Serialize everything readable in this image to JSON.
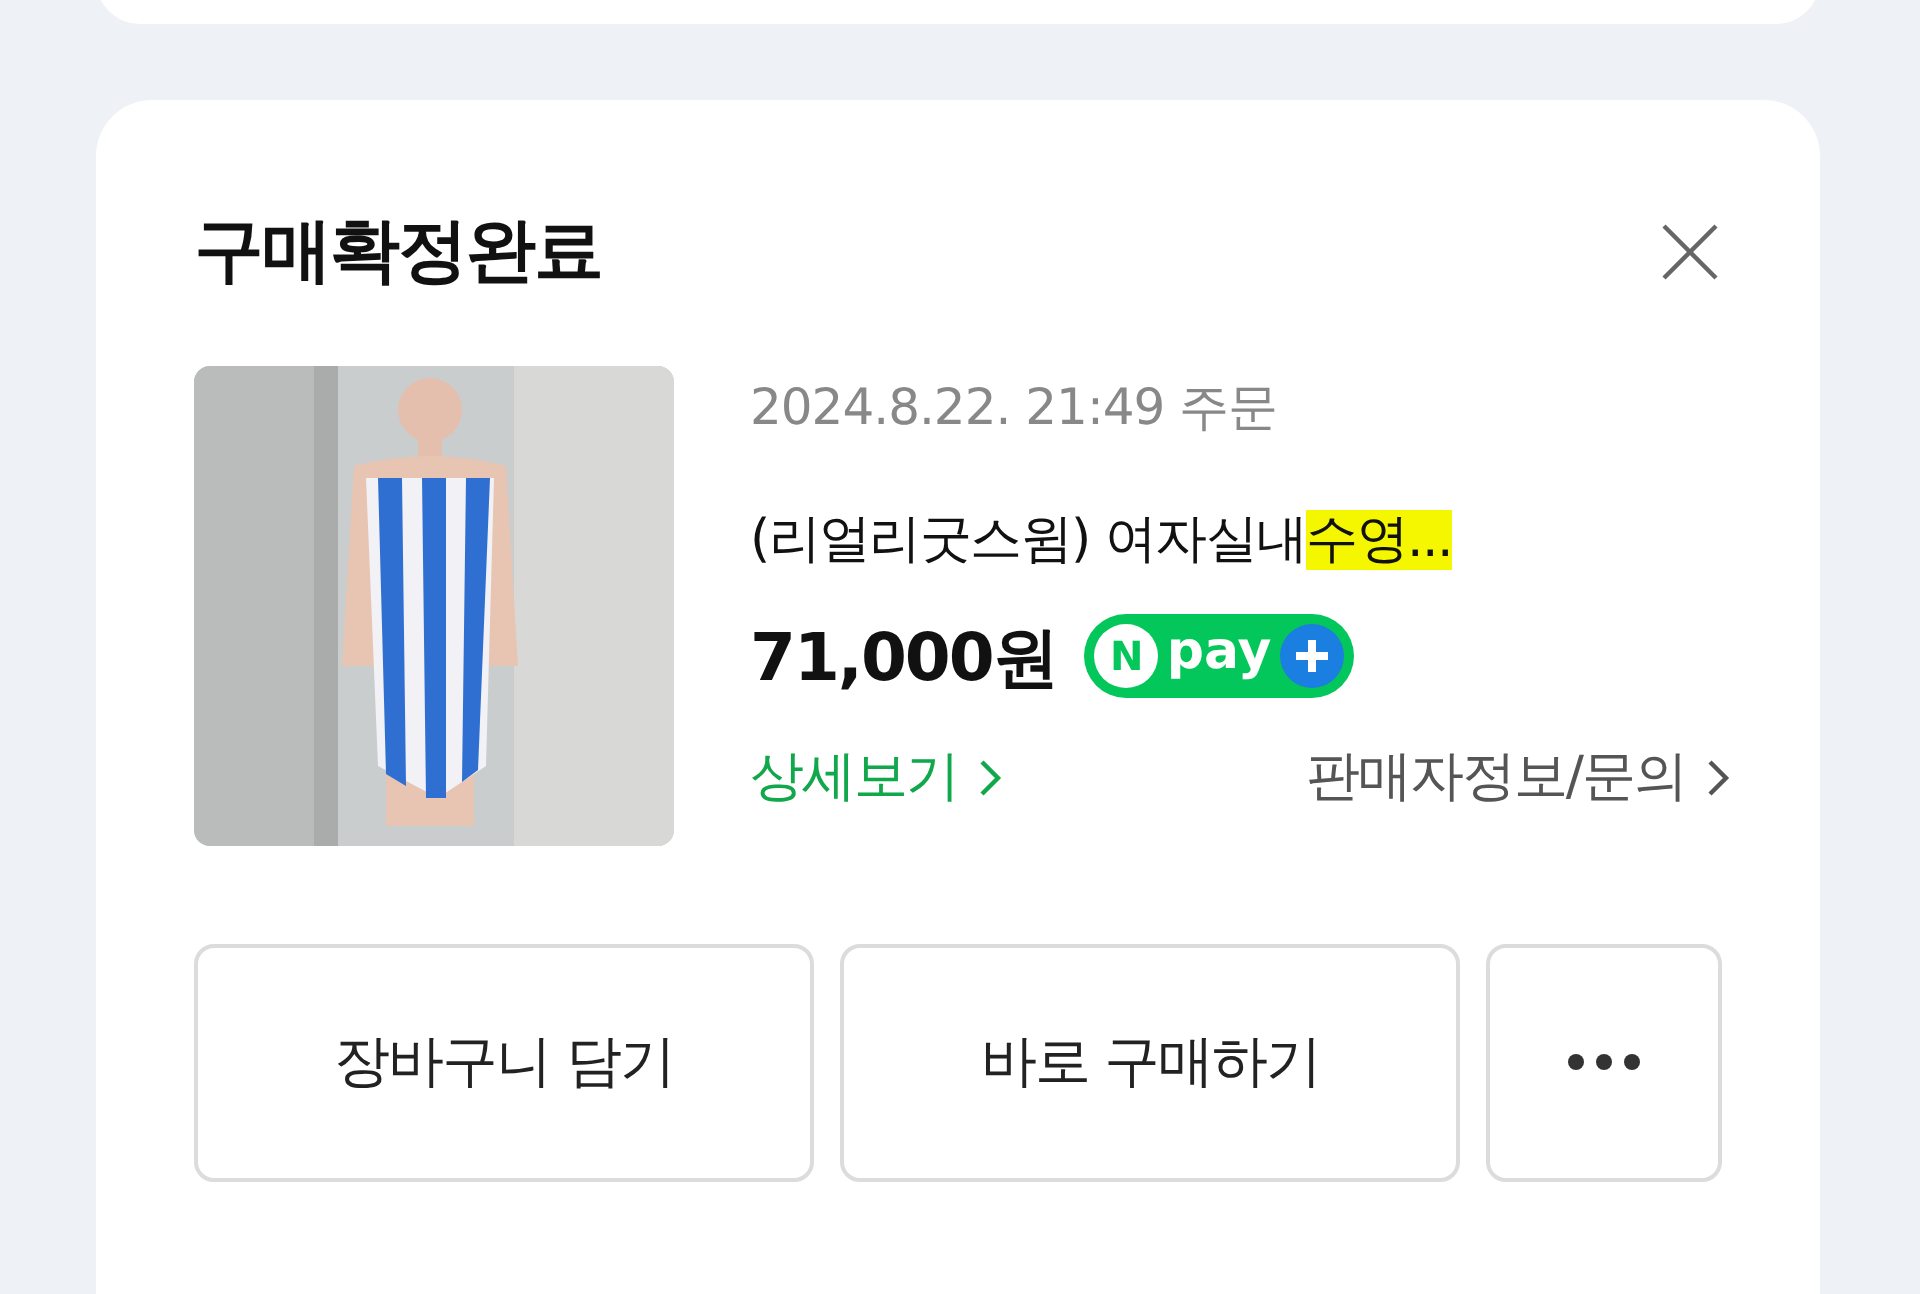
{
  "card": {
    "title": "구매확정완료",
    "order": {
      "date": "2024.8.22. 21:49 주문",
      "name_parts": [
        {
          "text": "(리얼리굿스윔) 여자실내",
          "highlighted": false
        },
        {
          "text": "수영...",
          "highlighted": true
        }
      ],
      "price": "71,000원",
      "npay": {
        "mark": "N",
        "text": "pay"
      },
      "links": [
        {
          "label": "상세보기",
          "kind": "primary"
        },
        {
          "label": "판매자정보/문의",
          "kind": "secondary"
        }
      ]
    },
    "buttons": [
      {
        "label": "장바구니 담기"
      },
      {
        "label": "바로 구매하기"
      }
    ]
  }
}
